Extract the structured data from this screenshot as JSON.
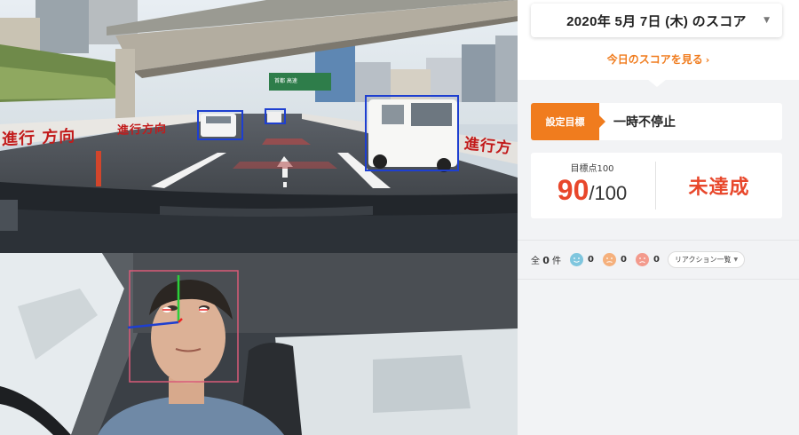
{
  "road_overlays": {
    "direction_text_1": "進行 方向",
    "direction_text_2": "進行方向",
    "direction_text_3": "進行方",
    "sign_text": "首都 高速"
  },
  "score_header": {
    "date_label": "2020年 5月 7日 (木) のスコア",
    "dropdown_icon": "triangle-down-icon",
    "view_today_link": "今日のスコアを見る",
    "link_arrow": "›"
  },
  "goal": {
    "badge_label": "設定目標",
    "value": "一時不停止"
  },
  "score": {
    "target_label": "目標点100",
    "value": "90",
    "max": "/100",
    "result": "未達成"
  },
  "reactions": {
    "total_prefix": "全",
    "total_count": "0",
    "total_suffix": "件",
    "items": [
      {
        "icon": "happy-face-icon",
        "color": "#7fc6de",
        "count": "0"
      },
      {
        "icon": "neutral-face-icon",
        "color": "#f5b07c",
        "count": "0"
      },
      {
        "icon": "sad-face-icon",
        "color": "#f39a8c",
        "count": "0"
      }
    ],
    "list_button": "リアクション一覧"
  },
  "colors": {
    "accent": "#f07c1e",
    "score_red": "#e8472b",
    "detect_blue": "#1e3fd0",
    "face_box": "#d95a78"
  }
}
